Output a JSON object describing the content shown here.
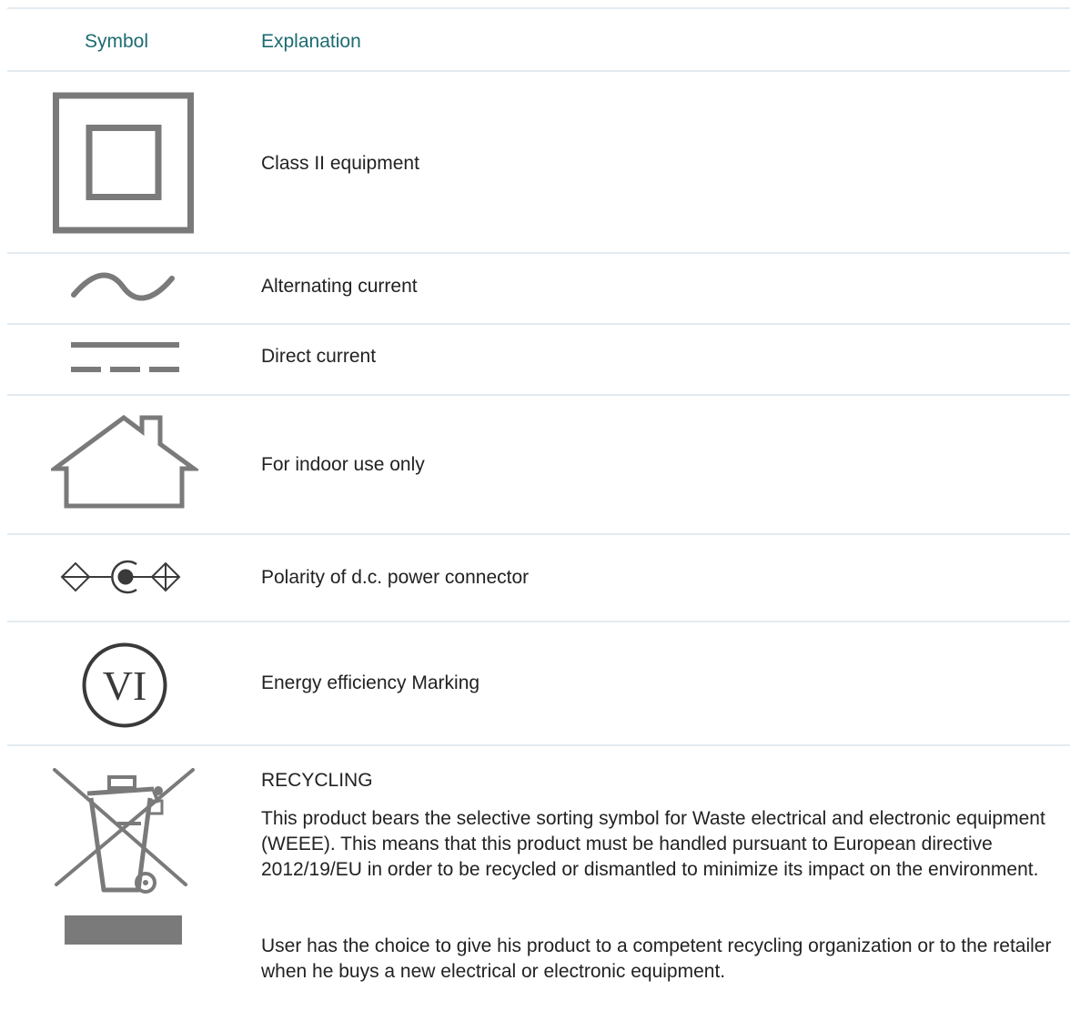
{
  "table": {
    "headers": {
      "symbol": "Symbol",
      "explanation": "Explanation"
    },
    "rows": [
      {
        "symbol_icon": "class-ii-double-square-icon",
        "explanation": "Class II equipment"
      },
      {
        "symbol_icon": "alternating-current-icon",
        "explanation": "Alternating current"
      },
      {
        "symbol_icon": "direct-current-icon",
        "explanation": "Direct current"
      },
      {
        "symbol_icon": "indoor-house-icon",
        "explanation": "For indoor use only"
      },
      {
        "symbol_icon": "dc-polarity-icon",
        "explanation": "Polarity of d.c. power connector"
      },
      {
        "symbol_icon": "energy-efficiency-vi-icon",
        "symbol_text": "VI",
        "explanation": "Energy efficiency Marking"
      },
      {
        "symbol_icon": "weee-crossed-bin-icon",
        "title": "RECYCLING",
        "paragraphs": [
          "This product bears the selective sorting symbol for Waste electrical and electronic equipment (WEEE). This means that this product must be handled pursuant to European directive 2012/19/EU in order to be recycled or dismantled to minimize its impact on the environment.",
          "User has the choice to give his product to a competent recycling organization or to the retailer when he buys a new electrical or electronic equipment."
        ]
      }
    ]
  },
  "colors": {
    "header_text": "#1c6b71",
    "body_text": "#222222",
    "rule": "#e3ebf1",
    "icon": "#7a7a7a",
    "icon_dark": "#3a3a3a"
  }
}
